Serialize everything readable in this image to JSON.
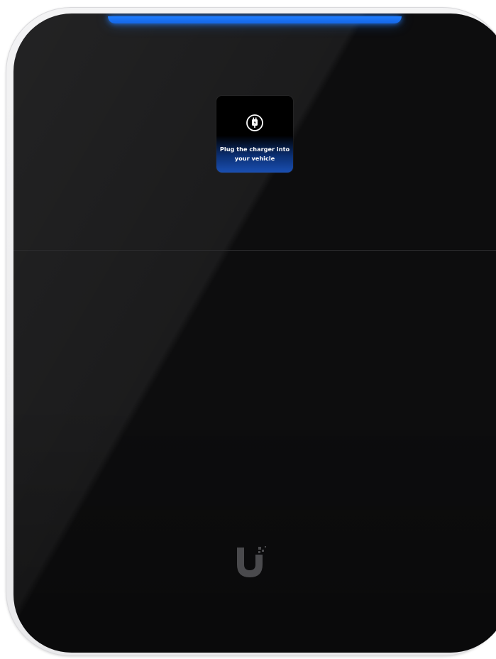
{
  "device": {
    "status_led_color": "#1f7dff",
    "screen": {
      "icon": "plug-icon",
      "message_line_1": "Plug the charger into",
      "message_line_2": "your vehicle"
    },
    "logo": "brand-u-logo"
  }
}
